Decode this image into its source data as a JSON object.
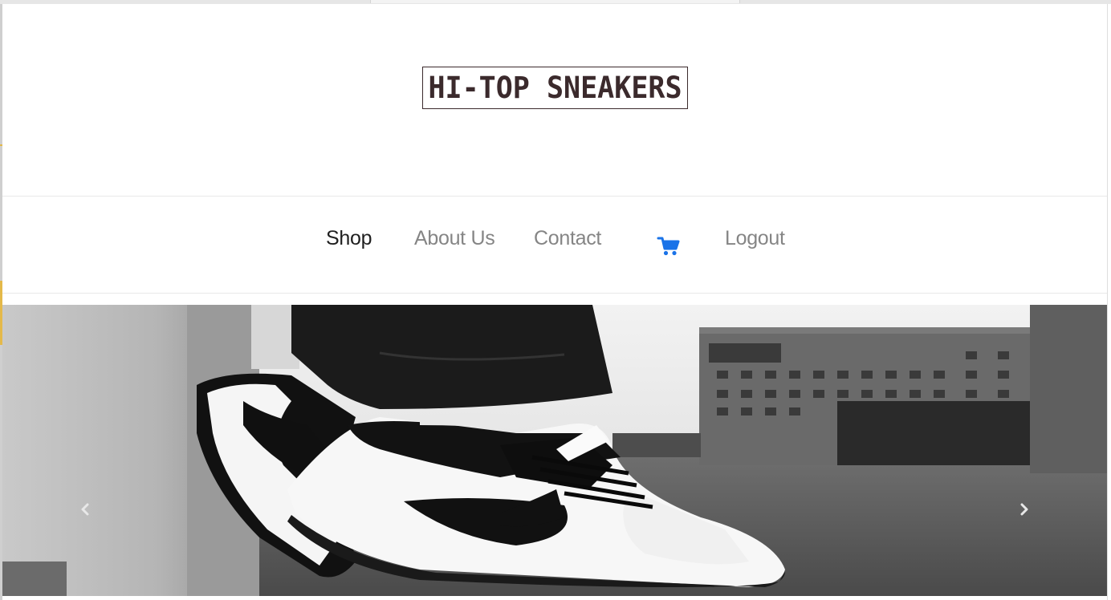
{
  "header": {
    "logo_text": "HI-TOP SNEAKERS"
  },
  "nav": {
    "items": [
      {
        "label": "Shop",
        "active": true
      },
      {
        "label": "About Us",
        "active": false
      },
      {
        "label": "Contact",
        "active": false
      },
      {
        "label": "Logout",
        "active": false
      }
    ],
    "cart_icon": "shopping-cart-icon",
    "cart_color": "#1a73e8"
  },
  "hero": {
    "image": "black-and-white-low-top-sneakers-photo",
    "prev_icon": "chevron-left-icon",
    "next_icon": "chevron-right-icon"
  },
  "colors": {
    "logo": "#3b2a2c",
    "nav_text": "#858585",
    "nav_active": "#1f1f1f"
  }
}
